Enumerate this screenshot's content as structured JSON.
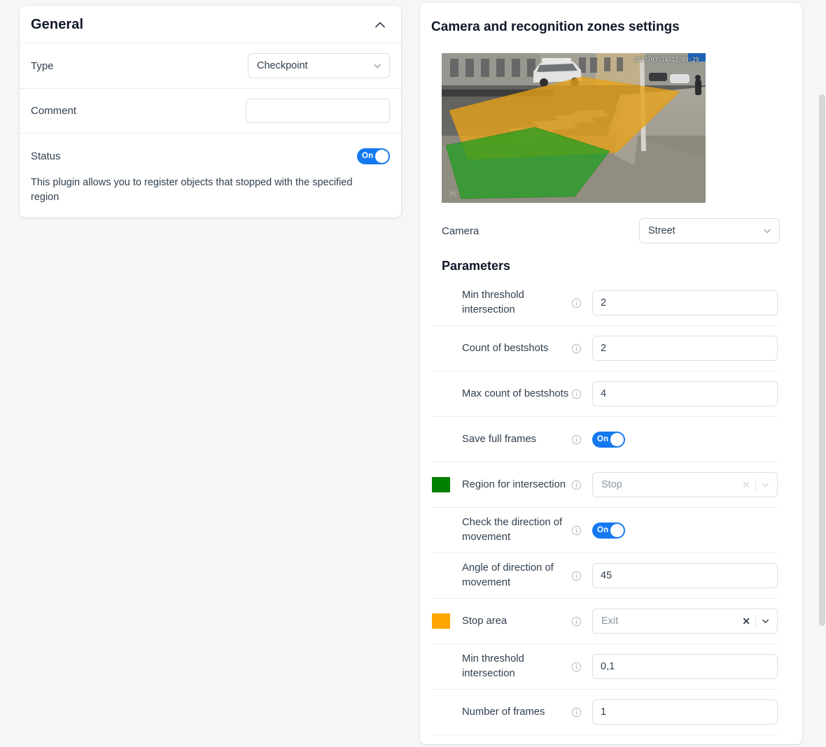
{
  "general": {
    "title": "General",
    "collapse_icon": "chevron-up-icon",
    "type": {
      "label": "Type",
      "value": "Checkpoint"
    },
    "comment": {
      "label": "Comment",
      "value": "",
      "placeholder": ""
    },
    "status": {
      "label": "Status",
      "toggle_label": "On",
      "enabled": true
    },
    "description": "This plugin allows you to register objects that stopped with the specified region"
  },
  "camera_panel": {
    "title": "Camera and recognition zones settings",
    "preview": {
      "timestamp": "2022-03-14 12:09:29",
      "watermark": "FC",
      "zone_orange_color": "#E8A317",
      "zone_green_color": "#1E9E1E"
    },
    "camera": {
      "label": "Camera",
      "value": "Street"
    },
    "parameters_title": "Parameters",
    "parameters": [
      {
        "label": "Min threshold intersection",
        "info": "info-icon",
        "control": "input",
        "value": "2",
        "swatch": null
      },
      {
        "label": "Count of bestshots",
        "info": "info-icon",
        "control": "input",
        "value": "2",
        "swatch": null
      },
      {
        "label": "Max count of bestshots",
        "info": "info-icon",
        "control": "input",
        "value": "4",
        "swatch": null
      },
      {
        "label": "Save full frames",
        "info": "info-icon",
        "control": "toggle",
        "toggle_label": "On",
        "enabled": true,
        "swatch": null
      },
      {
        "label": "Region for intersection",
        "info": "info-icon",
        "control": "select",
        "value": "Stop",
        "swatch": "#008000",
        "clear_icon": "clear-icon",
        "chevron": "chevron-down-icon",
        "dim": true
      },
      {
        "label": "Check the direction of movement",
        "info": "info-icon",
        "control": "toggle",
        "toggle_label": "On",
        "enabled": true,
        "swatch": null
      },
      {
        "label": "Angle of direction of movement",
        "info": "info-icon",
        "control": "input",
        "value": "45",
        "swatch": null
      },
      {
        "label": "Stop area",
        "info": "info-icon",
        "control": "select",
        "value": "Exit",
        "swatch": "#FFA500",
        "clear_icon": "clear-icon",
        "chevron": "chevron-down-icon",
        "dim": false
      },
      {
        "label": "Min threshold intersection",
        "info": "info-icon",
        "control": "input",
        "value": "0,1",
        "swatch": null
      },
      {
        "label": "Number of frames",
        "info": "info-icon",
        "control": "input",
        "value": "1",
        "swatch": null
      }
    ]
  },
  "theme": {
    "accent": "#1479F0",
    "page_bg": "#F6F6F6",
    "panel_bg": "#FFFFFF",
    "label_color": "#31404F"
  }
}
